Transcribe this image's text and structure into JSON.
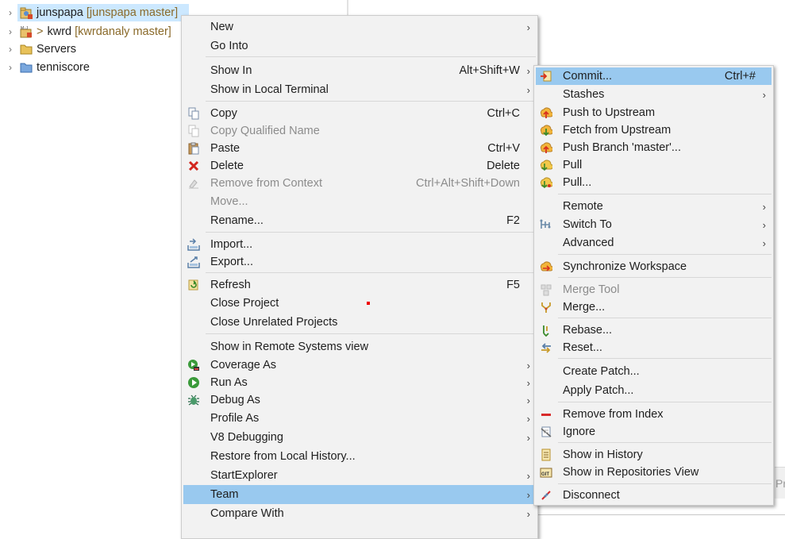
{
  "explorer": {
    "projects": [
      {
        "name": "junspapa",
        "git": "[junspapa master]",
        "prefix": "",
        "selected": true,
        "icon": "java-project-icon"
      },
      {
        "name": "kwrd",
        "git": "[kwrdanaly master]",
        "prefix": ">",
        "selected": false,
        "icon": "maven-project-icon"
      },
      {
        "name": "Servers",
        "git": "",
        "prefix": "",
        "selected": false,
        "icon": "folder-icon"
      },
      {
        "name": "tenniscore",
        "git": "",
        "prefix": "",
        "selected": false,
        "icon": "folder-icon"
      }
    ]
  },
  "partial_text": "Pro",
  "context_menu": {
    "new": "New",
    "go_into": "Go Into",
    "show_in": "Show In",
    "show_in_shortcut": "Alt+Shift+W",
    "show_in_local_terminal": "Show in Local Terminal",
    "copy": "Copy",
    "copy_shortcut": "Ctrl+C",
    "copy_qualified_name": "Copy Qualified Name",
    "paste": "Paste",
    "paste_shortcut": "Ctrl+V",
    "delete": "Delete",
    "delete_shortcut": "Delete",
    "remove_from_context": "Remove from Context",
    "remove_from_context_shortcut": "Ctrl+Alt+Shift+Down",
    "move": "Move...",
    "rename": "Rename...",
    "rename_shortcut": "F2",
    "import": "Import...",
    "export": "Export...",
    "refresh": "Refresh",
    "refresh_shortcut": "F5",
    "close_project": "Close Project",
    "close_unrelated_projects": "Close Unrelated Projects",
    "show_in_remote_systems_view": "Show in Remote Systems view",
    "coverage_as": "Coverage As",
    "run_as": "Run As",
    "debug_as": "Debug As",
    "profile_as": "Profile As",
    "v8_debugging": "V8 Debugging",
    "restore_from_local_history": "Restore from Local History...",
    "startexplorer": "StartExplorer",
    "team": "Team",
    "compare_with": "Compare With"
  },
  "team_menu": {
    "commit": "Commit...",
    "commit_shortcut": "Ctrl+#",
    "stashes": "Stashes",
    "push_to_upstream": "Push to Upstream",
    "fetch_from_upstream": "Fetch from Upstream",
    "push_branch": "Push Branch 'master'...",
    "pull": "Pull",
    "pull_dialog": "Pull...",
    "remote": "Remote",
    "switch_to": "Switch To",
    "advanced": "Advanced",
    "synchronize_workspace": "Synchronize Workspace",
    "merge_tool": "Merge Tool",
    "merge": "Merge...",
    "rebase": "Rebase...",
    "reset": "Reset...",
    "create_patch": "Create Patch...",
    "apply_patch": "Apply Patch...",
    "remove_from_index": "Remove from Index",
    "ignore": "Ignore",
    "show_in_history": "Show in History",
    "show_in_repositories_view": "Show in Repositories View",
    "disconnect": "Disconnect"
  },
  "colors": {
    "menu_background": "#f2f2f2",
    "highlight": "#99c9ef",
    "selection": "#cce8ff",
    "disabled_text": "#8c8c8c",
    "git_decoration": "#8a6a2a"
  }
}
